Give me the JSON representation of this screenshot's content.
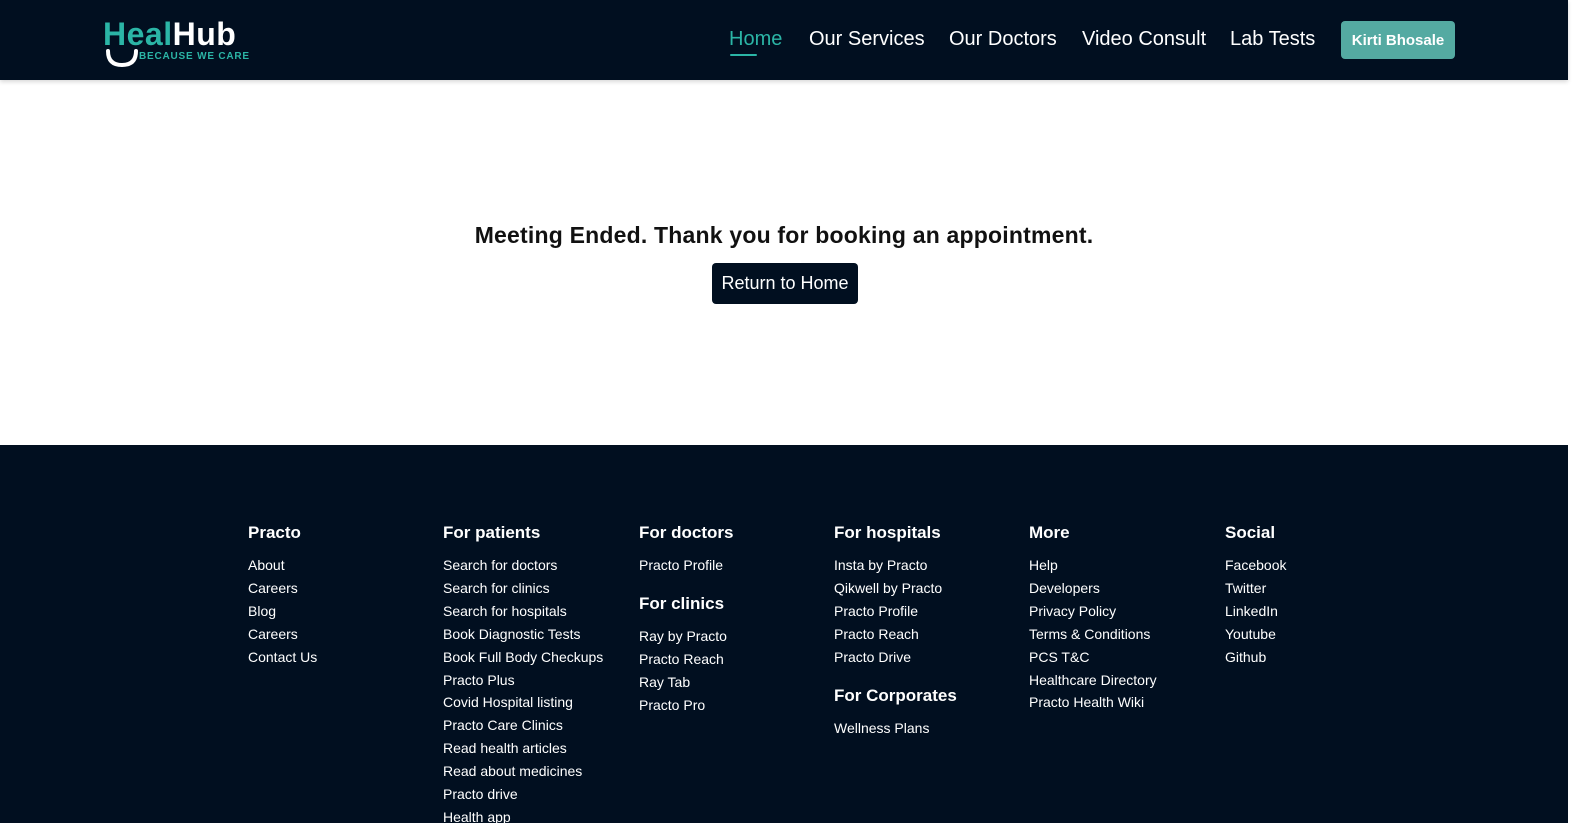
{
  "logo": {
    "heal": "Heal",
    "hub": "Hub",
    "tagline": "BECAUSE WE CARE"
  },
  "nav": {
    "links": [
      {
        "label": "Home"
      },
      {
        "label": "Our Services"
      },
      {
        "label": "Our Doctors"
      },
      {
        "label": "Video Consult"
      },
      {
        "label": "Lab Tests"
      }
    ],
    "active": "Home",
    "user_button": "Kirti Bhosale"
  },
  "main": {
    "message": "Meeting Ended. Thank you for booking an appointment.",
    "return_button": "Return to Home"
  },
  "footer": {
    "practo": {
      "title": "Practo",
      "links": [
        "About",
        "Careers",
        "Blog",
        "Careers",
        "Contact Us"
      ]
    },
    "patients": {
      "title": "For patients",
      "links": [
        "Search for doctors",
        "Search for clinics",
        "Search for hospitals",
        "Book Diagnostic Tests",
        "Book Full Body Checkups",
        "Practo Plus",
        "Covid Hospital listing",
        "Practo Care Clinics",
        "Read health articles",
        "Read about medicines",
        "Practo drive",
        "Health app"
      ]
    },
    "doctors": {
      "title": "For doctors",
      "links": [
        "Practo Profile"
      ]
    },
    "clinics": {
      "title": "For clinics",
      "links": [
        "Ray by Practo",
        "Practo Reach",
        "Ray Tab",
        "Practo Pro"
      ]
    },
    "hospitals": {
      "title": "For hospitals",
      "links": [
        "Insta by Practo",
        "Qikwell by Practo",
        "Practo Profile",
        "Practo Reach",
        "Practo Drive"
      ]
    },
    "corporates": {
      "title": "For Corporates",
      "links": [
        "Wellness Plans"
      ]
    },
    "more": {
      "title": "More",
      "links": [
        "Help",
        "Developers",
        "Privacy Policy",
        "Terms & Conditions",
        "PCS T&C",
        "Healthcare Directory",
        "Practo Health Wiki"
      ]
    },
    "social": {
      "title": "Social",
      "links": [
        "Facebook",
        "Twitter",
        "LinkedIn",
        "Youtube",
        "Github"
      ]
    }
  },
  "colors": {
    "navy": "#010f20",
    "teal": "#2bb5a6",
    "button_teal": "#54aaa2"
  }
}
